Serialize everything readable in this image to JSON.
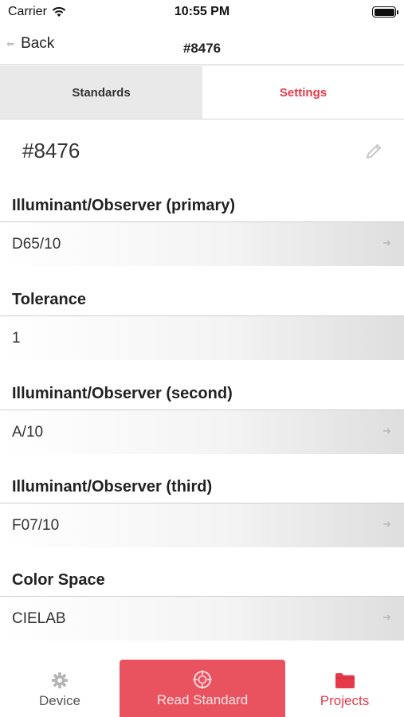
{
  "status_bar": {
    "carrier": "Carrier",
    "time": "10:55 PM"
  },
  "nav": {
    "back_label": "Back",
    "title": "#8476"
  },
  "tabs": [
    {
      "label": "Standards",
      "active": false
    },
    {
      "label": "Settings",
      "active": true
    }
  ],
  "standard_name": "#8476",
  "sections": [
    {
      "label": "Illuminant/Observer (primary)",
      "value": "D65/10",
      "has_arrow": true
    },
    {
      "label": "Tolerance",
      "value": "1",
      "has_arrow": false
    },
    {
      "label": "Illuminant/Observer (second)",
      "value": "A/10",
      "has_arrow": true
    },
    {
      "label": "Illuminant/Observer (third)",
      "value": "F07/10",
      "has_arrow": true
    },
    {
      "label": "Color Space",
      "value": "CIELAB",
      "has_arrow": true
    }
  ],
  "tab_bar": {
    "device": {
      "label": "Device",
      "icon": "gear-icon"
    },
    "read": {
      "label": "Read Standard",
      "icon": "crosshair-icon"
    },
    "projects": {
      "label": "Projects",
      "icon": "folder-icon"
    }
  },
  "colors": {
    "accent": "#e63a4a",
    "read_button": "#e9535f"
  }
}
